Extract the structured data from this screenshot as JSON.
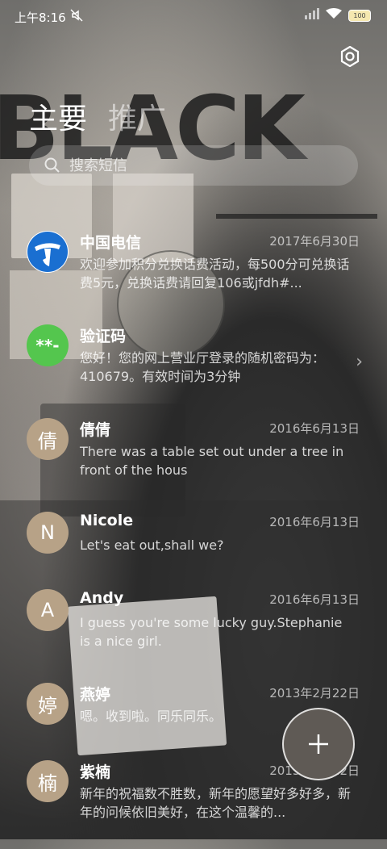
{
  "status": {
    "time": "上午8:16",
    "battery": "100"
  },
  "wallpaper": {
    "word": "BLACK"
  },
  "tabs": [
    {
      "label": "主要"
    },
    {
      "label": "推广"
    }
  ],
  "search": {
    "placeholder": "搜索短信"
  },
  "conversations": [
    {
      "avatar": "",
      "name": "中国电信",
      "date": "2017年6月30日",
      "preview": "欢迎参加积分兑换话费活动，每500分可兑换话费5元，兑换话费请回复106或jfdh#..."
    },
    {
      "avatar": "**-",
      "name": "验证码",
      "date": "",
      "preview": "您好！您的网上营业厅登录的随机密码为：410679。有效时间为3分钟"
    },
    {
      "avatar": "倩",
      "name": "倩倩",
      "date": "2016年6月13日",
      "preview": "There was a table set out under a tree in front of the hous"
    },
    {
      "avatar": "N",
      "name": "Nicole",
      "date": "2016年6月13日",
      "preview": "Let's eat out,shall we?"
    },
    {
      "avatar": "A",
      "name": "Andy",
      "date": "2016年6月13日",
      "preview": "I guess you're some lucky guy.Stephanie is a nice girl."
    },
    {
      "avatar": "婷",
      "name": "燕婷",
      "date": "2013年2月22日",
      "preview": "嗯。收到啦。同乐同乐。"
    },
    {
      "avatar": "楠",
      "name": "紫楠",
      "date": "2013年2月22日",
      "preview": "新年的祝福数不胜数，新年的愿望好多好多，新年的问候依旧美好，在这个温馨的..."
    }
  ]
}
